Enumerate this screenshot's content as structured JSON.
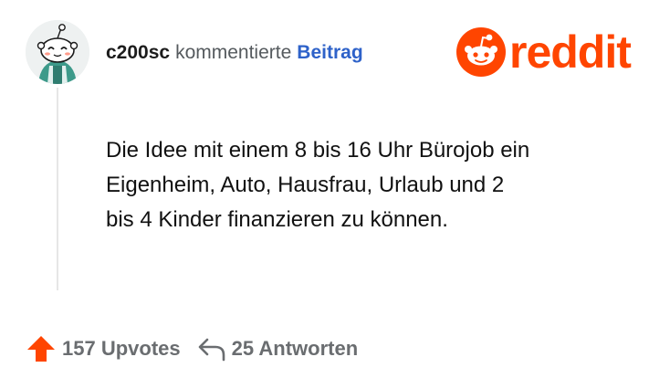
{
  "comment": {
    "author": "c200sc",
    "action": "kommentierte",
    "post_link": "Beitrag",
    "body": "Die Idee mit einem 8 bis 16 Uhr Bürojob ein\nEigenheim, Auto, Hausfrau, Urlaub und 2\nbis 4 Kinder finanzieren zu können."
  },
  "brand": {
    "logo_text": "reddit",
    "color": "#ff4500"
  },
  "footer": {
    "upvotes": "157 Upvotes",
    "replies": "25 Antworten"
  },
  "colors": {
    "link": "#2e62c9",
    "upvote": "#ff4500",
    "muted": "#6a6d70"
  },
  "icons": {
    "avatar": "snoo-avatar",
    "upvote": "upvote-arrow-icon",
    "reply": "reply-arrow-icon",
    "logo": "snoo-logo-icon"
  }
}
